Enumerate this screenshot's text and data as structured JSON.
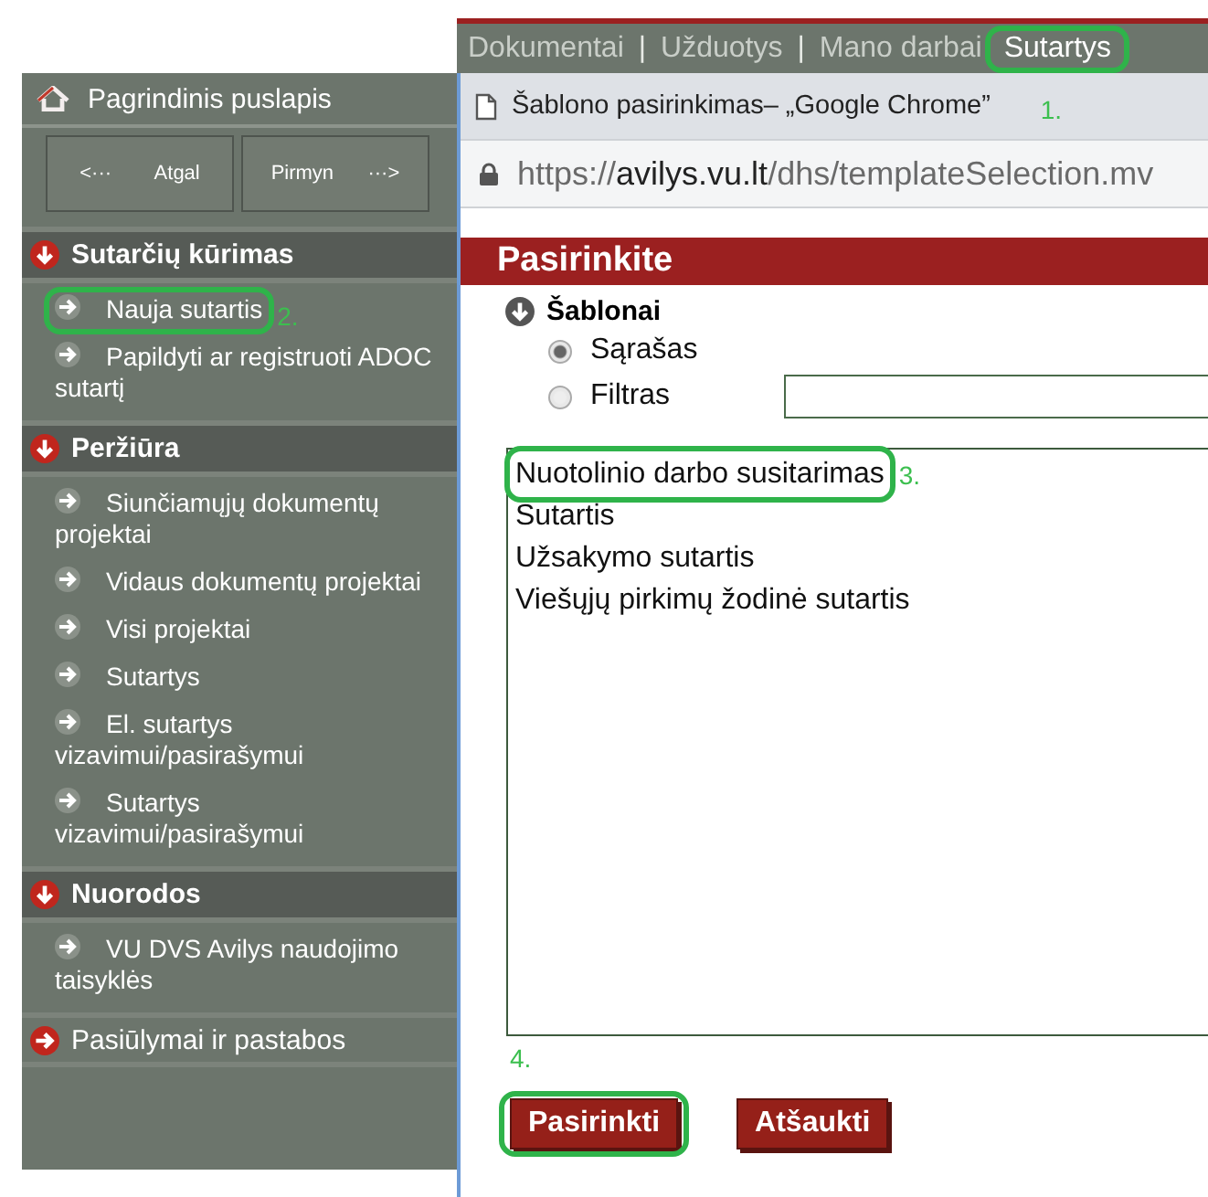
{
  "nav": {
    "items": [
      {
        "kind": "tab",
        "label": "Dokumentai",
        "selected": false
      },
      {
        "kind": "separator",
        "text": "|"
      },
      {
        "kind": "tab",
        "label": "Užduotys",
        "selected": false
      },
      {
        "kind": "separator",
        "text": "|"
      },
      {
        "kind": "tab",
        "label": "Mano darbai",
        "selected": false
      },
      {
        "kind": "tab",
        "label": "Sutartys",
        "selected": true,
        "step": "1."
      }
    ]
  },
  "sidebar": {
    "home": "Pagrindinis puslapis",
    "history_buttons": [
      {
        "kind": "back",
        "arrow": "<···",
        "label": "Atgal"
      },
      {
        "kind": "forward",
        "arrow": "···>",
        "label": "Pirmyn"
      }
    ],
    "sections": [
      {
        "kind": "group",
        "title": "Sutarčių kūrimas",
        "expanded": true,
        "items": [
          {
            "label": "Nauja sutartis",
            "step": "2."
          },
          {
            "label": "Papildyti ar registruoti ADOC sutartį"
          }
        ]
      },
      {
        "kind": "group",
        "title": "Peržiūra",
        "expanded": true,
        "items": [
          {
            "label": "Siunčiamųjų dokumentų projektai"
          },
          {
            "label": "Vidaus dokumentų projektai"
          },
          {
            "label": "Visi projektai"
          },
          {
            "label": "Sutartys"
          },
          {
            "label": "El. sutartys vizavimui/pasirašymui"
          },
          {
            "label": "Sutartys vizavimui/pasirašymui"
          }
        ]
      },
      {
        "kind": "group",
        "title": "Nuorodos",
        "expanded": true,
        "items": [
          {
            "label": "VU DVS Avilys naudojimo taisyklės"
          }
        ]
      },
      {
        "kind": "link",
        "title": "Pasiūlymai ir pastabos"
      }
    ]
  },
  "window": {
    "title": "Šablono pasirinkimas– „Google Chrome”",
    "url": {
      "scheme": "https://",
      "host": "avilys.vu.lt",
      "path": "/dhs/templateSelection.mv"
    },
    "heading": "Pasirinkite",
    "section": "Šablonai",
    "radios": [
      {
        "kind": "plain",
        "label": "Sąrašas",
        "selected": true
      },
      {
        "kind": "with_field",
        "label": "Filtras",
        "selected": false
      }
    ],
    "templates": [
      {
        "label": "Nuotolinio darbo susitarimas",
        "step": "3."
      },
      {
        "label": "Sutartis"
      },
      {
        "label": "Užsakymo sutartis"
      },
      {
        "label": "Viešųjų pirkimų žodinė sutartis"
      }
    ],
    "buttons": [
      {
        "label": "Pasirinkti",
        "step": "4."
      },
      {
        "label": "Atšaukti"
      }
    ]
  }
}
